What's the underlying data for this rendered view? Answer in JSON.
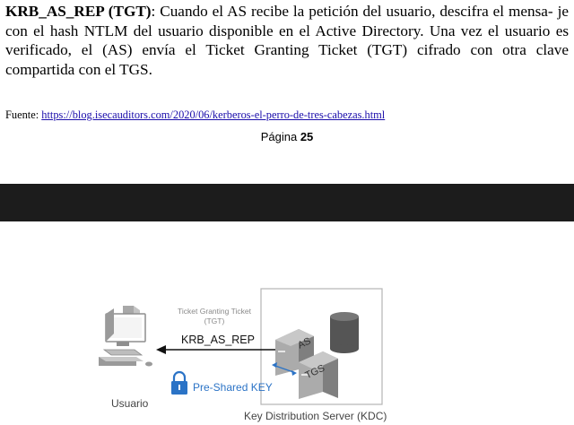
{
  "paragraph": {
    "term": "KRB_AS_REP (TGT)",
    "line1_rest": ": Cuando el AS recibe la petición del usuario, descifra el mensa-",
    "line2": "je con el hash NTLM del usuario disponible en el Active Directory. Una vez el usuario",
    "line3": "es verificado, el (AS) envía el Ticket Granting Ticket (TGT) cifrado con otra clave",
    "line4": "compartida con el TGS."
  },
  "source": {
    "label": "Fuente: ",
    "url": "https://blog.isecauditors.com/2020/06/kerberos-el-perro-de-tres-cabezas.html"
  },
  "page": {
    "label": "Página ",
    "number": "25"
  },
  "diagram": {
    "ticket_line1": "Ticket Granting Ticket",
    "ticket_line2": "(TGT)",
    "message": "KRB_AS_REP",
    "key_label": "Pre-Shared KEY",
    "user_label": "Usuario",
    "kdc_label": "Key Distribution Server (KDC)",
    "as_label": "AS",
    "tgs_label": "TGS",
    "colors": {
      "key_blue": "#2b73c6",
      "server_gray": "#8f8f8f",
      "box_border": "#b5b5b5"
    }
  }
}
